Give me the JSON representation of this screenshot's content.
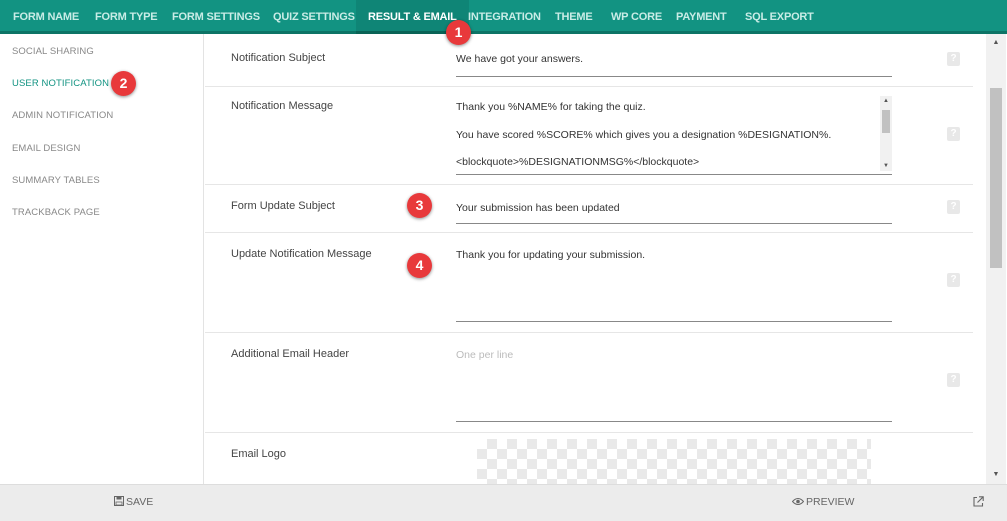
{
  "nav": {
    "tabs": [
      {
        "label": "FORM NAME"
      },
      {
        "label": "FORM TYPE"
      },
      {
        "label": "FORM SETTINGS"
      },
      {
        "label": "QUIZ SETTINGS"
      },
      {
        "label": "RESULT & EMAIL",
        "active": true
      },
      {
        "label": "INTEGRATION"
      },
      {
        "label": "THEME"
      },
      {
        "label": "WP CORE"
      },
      {
        "label": "PAYMENT"
      },
      {
        "label": "SQL EXPORT"
      }
    ]
  },
  "sidebar": {
    "items": [
      {
        "label": "SOCIAL SHARING"
      },
      {
        "label": "USER NOTIFICATION",
        "active": true
      },
      {
        "label": "ADMIN NOTIFICATION"
      },
      {
        "label": "EMAIL DESIGN"
      },
      {
        "label": "SUMMARY TABLES"
      },
      {
        "label": "TRACKBACK PAGE"
      }
    ]
  },
  "fields": {
    "notification_subject": {
      "label": "Notification Subject",
      "value": "We have got your answers."
    },
    "notification_message": {
      "label": "Notification Message",
      "lines": [
        "Thank you %NAME% for taking the quiz.",
        "You have scored %SCORE% which gives you a designation %DESIGNATION%.",
        "<blockquote>%DESIGNATIONMSG%</blockquote>"
      ]
    },
    "form_update_subject": {
      "label": "Form Update Subject",
      "value": "Your submission has been updated"
    },
    "update_notification_message": {
      "label": "Update Notification Message",
      "value": "Thank you for updating your submission."
    },
    "additional_email_header": {
      "label": "Additional Email Header",
      "placeholder": "One per line"
    },
    "email_logo": {
      "label": "Email Logo"
    }
  },
  "help_glyph": "?",
  "scroll_glyphs": {
    "up": "▲",
    "down": "▼"
  },
  "footer": {
    "save_label": "SAVE",
    "preview_label": "PREVIEW"
  },
  "badges": [
    "1",
    "2",
    "3",
    "4"
  ],
  "colors": {
    "accent": "#129382",
    "badge": "#e8393b"
  },
  "icons": [
    "save-icon",
    "eye-icon",
    "external-link-icon",
    "help-icon"
  ]
}
